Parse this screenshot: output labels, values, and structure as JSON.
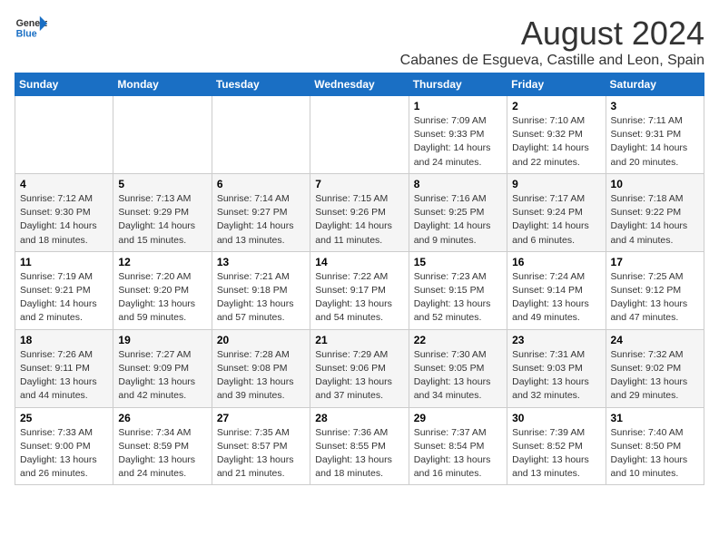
{
  "logo": {
    "general": "General",
    "blue": "Blue"
  },
  "title": "August 2024",
  "location": "Cabanes de Esgueva, Castille and Leon, Spain",
  "days_of_week": [
    "Sunday",
    "Monday",
    "Tuesday",
    "Wednesday",
    "Thursday",
    "Friday",
    "Saturday"
  ],
  "weeks": [
    [
      {
        "day": "",
        "info": ""
      },
      {
        "day": "",
        "info": ""
      },
      {
        "day": "",
        "info": ""
      },
      {
        "day": "",
        "info": ""
      },
      {
        "day": "1",
        "info": "Sunrise: 7:09 AM\nSunset: 9:33 PM\nDaylight: 14 hours and 24 minutes."
      },
      {
        "day": "2",
        "info": "Sunrise: 7:10 AM\nSunset: 9:32 PM\nDaylight: 14 hours and 22 minutes."
      },
      {
        "day": "3",
        "info": "Sunrise: 7:11 AM\nSunset: 9:31 PM\nDaylight: 14 hours and 20 minutes."
      }
    ],
    [
      {
        "day": "4",
        "info": "Sunrise: 7:12 AM\nSunset: 9:30 PM\nDaylight: 14 hours and 18 minutes."
      },
      {
        "day": "5",
        "info": "Sunrise: 7:13 AM\nSunset: 9:29 PM\nDaylight: 14 hours and 15 minutes."
      },
      {
        "day": "6",
        "info": "Sunrise: 7:14 AM\nSunset: 9:27 PM\nDaylight: 14 hours and 13 minutes."
      },
      {
        "day": "7",
        "info": "Sunrise: 7:15 AM\nSunset: 9:26 PM\nDaylight: 14 hours and 11 minutes."
      },
      {
        "day": "8",
        "info": "Sunrise: 7:16 AM\nSunset: 9:25 PM\nDaylight: 14 hours and 9 minutes."
      },
      {
        "day": "9",
        "info": "Sunrise: 7:17 AM\nSunset: 9:24 PM\nDaylight: 14 hours and 6 minutes."
      },
      {
        "day": "10",
        "info": "Sunrise: 7:18 AM\nSunset: 9:22 PM\nDaylight: 14 hours and 4 minutes."
      }
    ],
    [
      {
        "day": "11",
        "info": "Sunrise: 7:19 AM\nSunset: 9:21 PM\nDaylight: 14 hours and 2 minutes."
      },
      {
        "day": "12",
        "info": "Sunrise: 7:20 AM\nSunset: 9:20 PM\nDaylight: 13 hours and 59 minutes."
      },
      {
        "day": "13",
        "info": "Sunrise: 7:21 AM\nSunset: 9:18 PM\nDaylight: 13 hours and 57 minutes."
      },
      {
        "day": "14",
        "info": "Sunrise: 7:22 AM\nSunset: 9:17 PM\nDaylight: 13 hours and 54 minutes."
      },
      {
        "day": "15",
        "info": "Sunrise: 7:23 AM\nSunset: 9:15 PM\nDaylight: 13 hours and 52 minutes."
      },
      {
        "day": "16",
        "info": "Sunrise: 7:24 AM\nSunset: 9:14 PM\nDaylight: 13 hours and 49 minutes."
      },
      {
        "day": "17",
        "info": "Sunrise: 7:25 AM\nSunset: 9:12 PM\nDaylight: 13 hours and 47 minutes."
      }
    ],
    [
      {
        "day": "18",
        "info": "Sunrise: 7:26 AM\nSunset: 9:11 PM\nDaylight: 13 hours and 44 minutes."
      },
      {
        "day": "19",
        "info": "Sunrise: 7:27 AM\nSunset: 9:09 PM\nDaylight: 13 hours and 42 minutes."
      },
      {
        "day": "20",
        "info": "Sunrise: 7:28 AM\nSunset: 9:08 PM\nDaylight: 13 hours and 39 minutes."
      },
      {
        "day": "21",
        "info": "Sunrise: 7:29 AM\nSunset: 9:06 PM\nDaylight: 13 hours and 37 minutes."
      },
      {
        "day": "22",
        "info": "Sunrise: 7:30 AM\nSunset: 9:05 PM\nDaylight: 13 hours and 34 minutes."
      },
      {
        "day": "23",
        "info": "Sunrise: 7:31 AM\nSunset: 9:03 PM\nDaylight: 13 hours and 32 minutes."
      },
      {
        "day": "24",
        "info": "Sunrise: 7:32 AM\nSunset: 9:02 PM\nDaylight: 13 hours and 29 minutes."
      }
    ],
    [
      {
        "day": "25",
        "info": "Sunrise: 7:33 AM\nSunset: 9:00 PM\nDaylight: 13 hours and 26 minutes."
      },
      {
        "day": "26",
        "info": "Sunrise: 7:34 AM\nSunset: 8:59 PM\nDaylight: 13 hours and 24 minutes."
      },
      {
        "day": "27",
        "info": "Sunrise: 7:35 AM\nSunset: 8:57 PM\nDaylight: 13 hours and 21 minutes."
      },
      {
        "day": "28",
        "info": "Sunrise: 7:36 AM\nSunset: 8:55 PM\nDaylight: 13 hours and 18 minutes."
      },
      {
        "day": "29",
        "info": "Sunrise: 7:37 AM\nSunset: 8:54 PM\nDaylight: 13 hours and 16 minutes."
      },
      {
        "day": "30",
        "info": "Sunrise: 7:39 AM\nSunset: 8:52 PM\nDaylight: 13 hours and 13 minutes."
      },
      {
        "day": "31",
        "info": "Sunrise: 7:40 AM\nSunset: 8:50 PM\nDaylight: 13 hours and 10 minutes."
      }
    ]
  ]
}
